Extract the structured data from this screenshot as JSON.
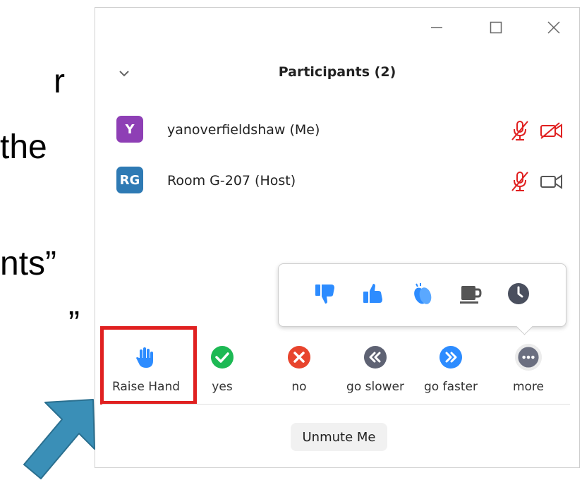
{
  "slide_fragments": [
    "r",
    "the",
    "nts”",
    "”"
  ],
  "window": {
    "title": "Participants (2)",
    "controls": [
      "minimize-icon",
      "maximize-icon",
      "close-icon"
    ]
  },
  "participants": [
    {
      "initials": "Y",
      "name": "yanoverfieldshaw (Me)",
      "avatar_color": "#8e3fb5",
      "mic": "muted",
      "video": "off"
    },
    {
      "initials": "RG",
      "name": "Room G-207 (Host)",
      "avatar_color": "#2e7ab4",
      "mic": "muted",
      "video": "on"
    }
  ],
  "reactions": [
    "thumbs-down-icon",
    "thumbs-up-icon",
    "clap-icon",
    "coffee-icon",
    "clock-icon"
  ],
  "feedback": [
    {
      "label": "Raise Hand",
      "icon": "hand-icon"
    },
    {
      "label": "yes",
      "icon": "check-icon"
    },
    {
      "label": "no",
      "icon": "x-icon"
    },
    {
      "label": "go slower",
      "icon": "rewind-icon"
    },
    {
      "label": "go faster",
      "icon": "fast-forward-icon"
    },
    {
      "label": "more",
      "icon": "more-icon"
    }
  ],
  "unmute_label": "Unmute Me",
  "colors": {
    "accent_blue": "#2d8cff",
    "muted_red": "#e02020",
    "yes_green": "#1db954",
    "no_red": "#e8442d",
    "slower_gray": "#5e6273",
    "more_gray": "#6b6f80",
    "arrow_teal": "#3a8fb7"
  }
}
